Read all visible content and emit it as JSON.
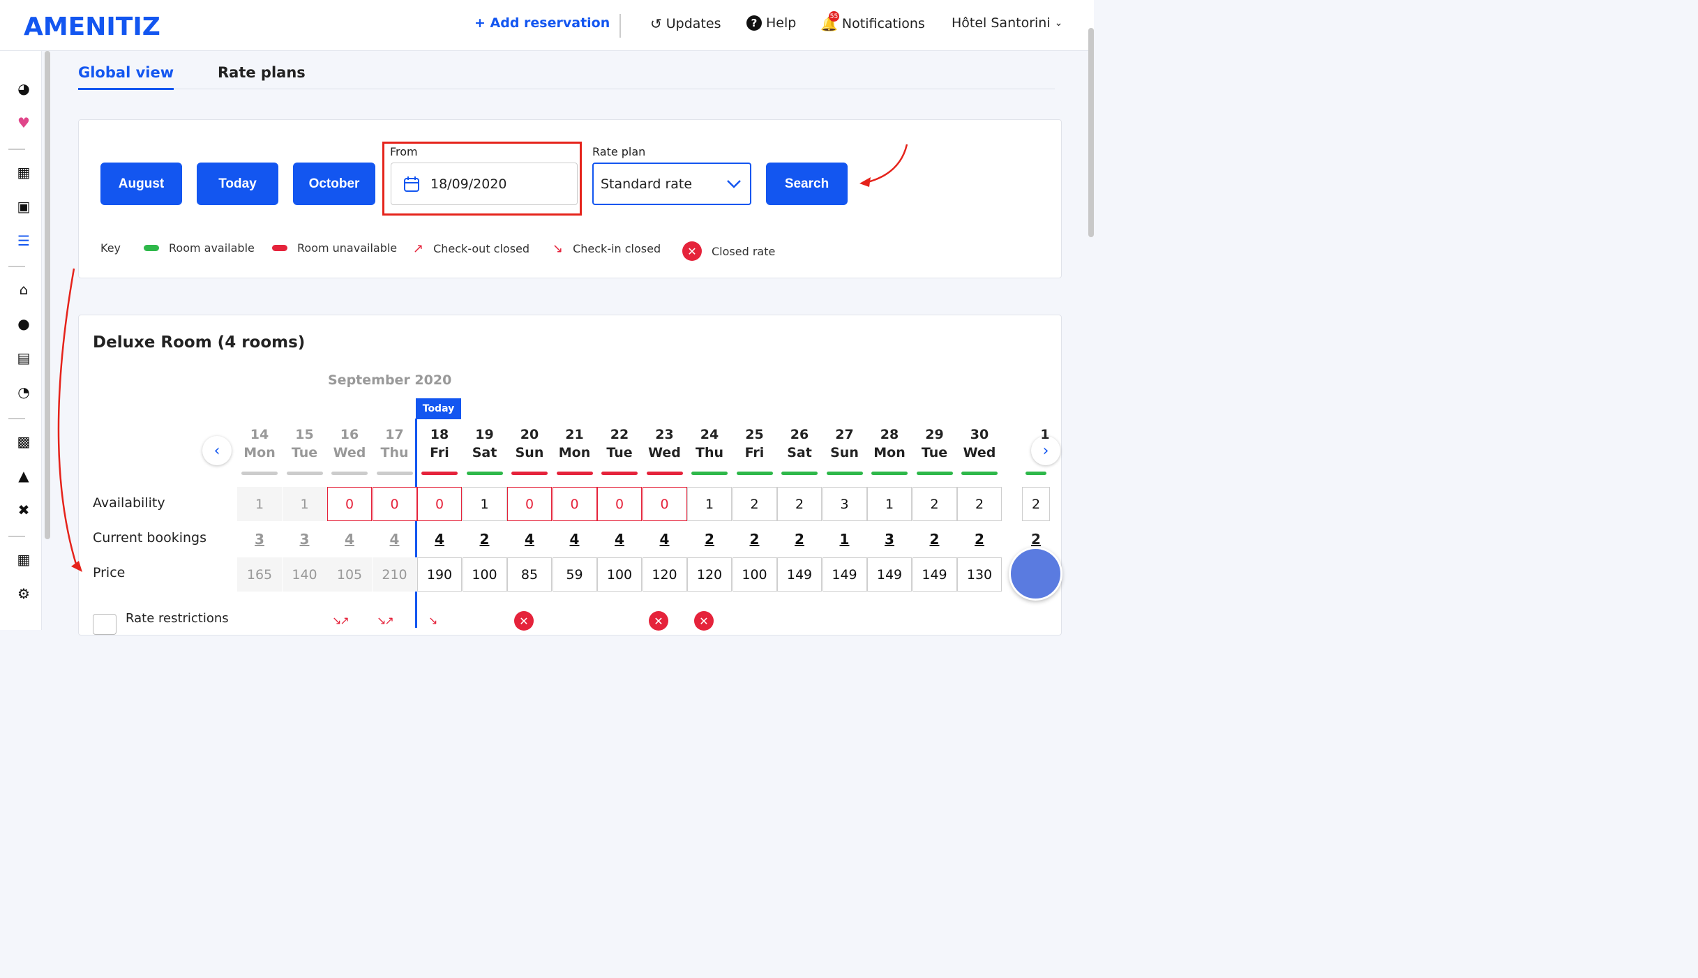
{
  "header": {
    "logo": "AMENITIZ",
    "add_reservation": "+ Add reservation",
    "updates": "Updates",
    "help": "Help",
    "notifications": "Notifications",
    "notifications_count": "55",
    "hotel": "Hôtel Santorini"
  },
  "tabs": [
    {
      "label": "Global view",
      "active": true
    },
    {
      "label": "Rate plans",
      "active": false
    }
  ],
  "filters": {
    "buttons": [
      "August",
      "Today",
      "October"
    ],
    "from_label": "From",
    "from_value": "18/09/2020",
    "rate_plan_label": "Rate plan",
    "rate_plan_value": "Standard rate",
    "search_label": "Search"
  },
  "key": {
    "title": "Key",
    "items": [
      "Room available",
      "Room unavailable",
      "Check-out closed",
      "Check-in closed",
      "Closed rate"
    ]
  },
  "room": {
    "title": "Deluxe Room (4 rooms)",
    "month": "September 2020",
    "today_label": "Today",
    "row_labels": [
      "Availability",
      "Current bookings",
      "Price"
    ],
    "rate_restrictions_label": "Rate restrictions",
    "days": [
      {
        "num": "14",
        "day": "Mon",
        "avail": "1",
        "book": "3",
        "price": "165"
      },
      {
        "num": "15",
        "day": "Tue",
        "avail": "1",
        "book": "3",
        "price": "140"
      },
      {
        "num": "16",
        "day": "Wed",
        "avail": "0",
        "book": "4",
        "price": "105"
      },
      {
        "num": "17",
        "day": "Thu",
        "avail": "0",
        "book": "4",
        "price": "210"
      },
      {
        "num": "18",
        "day": "Fri",
        "avail": "0",
        "book": "4",
        "price": "190"
      },
      {
        "num": "19",
        "day": "Sat",
        "avail": "1",
        "book": "2",
        "price": "100"
      },
      {
        "num": "20",
        "day": "Sun",
        "avail": "0",
        "book": "4",
        "price": "85"
      },
      {
        "num": "21",
        "day": "Mon",
        "avail": "0",
        "book": "4",
        "price": "59"
      },
      {
        "num": "22",
        "day": "Tue",
        "avail": "0",
        "book": "4",
        "price": "100"
      },
      {
        "num": "23",
        "day": "Wed",
        "avail": "0",
        "book": "4",
        "price": "120"
      },
      {
        "num": "24",
        "day": "Thu",
        "avail": "1",
        "book": "2",
        "price": "120"
      },
      {
        "num": "25",
        "day": "Fri",
        "avail": "2",
        "book": "2",
        "price": "100"
      },
      {
        "num": "26",
        "day": "Sat",
        "avail": "2",
        "book": "2",
        "price": "149"
      },
      {
        "num": "27",
        "day": "Sun",
        "avail": "3",
        "book": "1",
        "price": "149"
      },
      {
        "num": "28",
        "day": "Mon",
        "avail": "1",
        "book": "3",
        "price": "149"
      },
      {
        "num": "29",
        "day": "Tue",
        "avail": "2",
        "book": "2",
        "price": "149"
      },
      {
        "num": "30",
        "day": "Wed",
        "avail": "2",
        "book": "2",
        "price": "130"
      }
    ],
    "next_col": {
      "num": "1",
      "avail": "2",
      "book": "2"
    }
  },
  "colors": {
    "accent": "#1356f0",
    "red": "#e5233b",
    "green": "#2eb84a",
    "grey": "#cccccc"
  }
}
